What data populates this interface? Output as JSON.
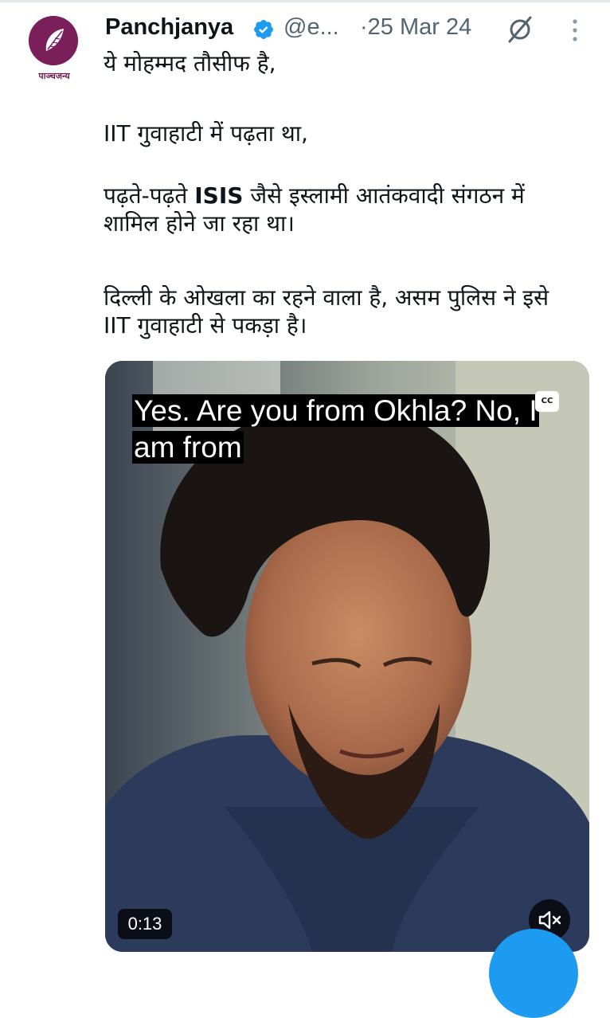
{
  "tweet": {
    "author_name": "Panchjanya",
    "author_handle": "@e...",
    "separator": "·",
    "date": "25 Mar 24",
    "avatar_label": "पाञ्चजन्य",
    "paragraphs": [
      "ये मोहम्मद तौसीफ है,",
      "IIT गुवाहाटी में पढ़ता था,",
      "पढ़ते-पढ़ते ISIS जैसे इस्लामी आतंकवादी संगठन में शामिल होने जा रहा था।",
      "दिल्ली के ओखला का रहने वाला है, असम पुलिस ने इसे IIT गुवाहाटी से पकड़ा है।"
    ],
    "p3_before": "पढ़ते-पढ़ते ",
    "p3_bold": "ISIS",
    "p3_after": " जैसे इस्लामी आतंकवादी संगठन में\nशामिल होने जा रहा था।",
    "p4_display": "दिल्ली के ओखला का रहने वाला है, असम पुलिस ने इसे\nIIT गुवाहाटी से पकड़ा है।"
  },
  "video": {
    "caption": "Yes. Are you from Okhla? No, I am from",
    "cc_label": "CC",
    "timestamp": "0:13",
    "muted": true
  },
  "icons": {
    "verified": "verified-badge-icon",
    "grok": "grok-icon",
    "more": "more-vertical-icon",
    "mute": "volume-muted-icon",
    "cc": "closed-captions-icon"
  },
  "colors": {
    "accent": "#1d9bf0",
    "text": "#0f1419",
    "secondary": "#536471",
    "avatar": "#7a1f5a"
  }
}
